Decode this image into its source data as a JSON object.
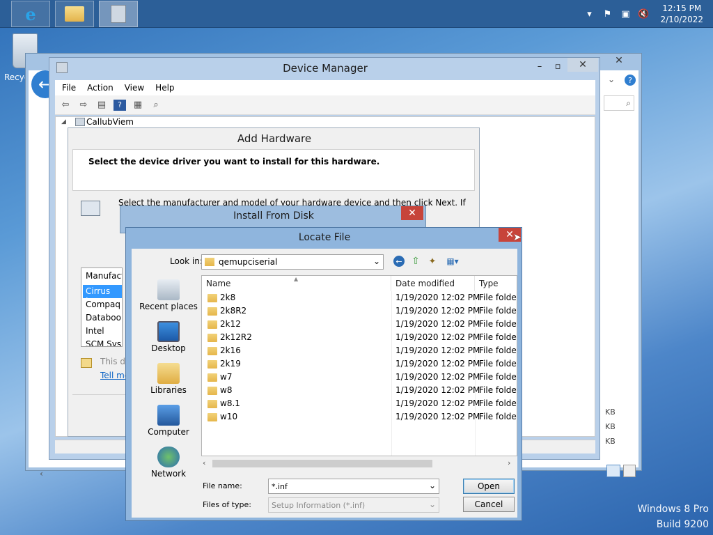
{
  "taskbar": {
    "clock_time": "12:15 PM",
    "clock_date": "2/10/2022"
  },
  "desktop": {
    "recycle_label": "Recyc",
    "watermark_line1": "Windows 8 Pro",
    "watermark_line2": "Build 9200"
  },
  "explorer": {
    "sizes": [
      "KB",
      "KB",
      "KB"
    ]
  },
  "device_manager": {
    "title": "Device Manager",
    "menu": [
      "File",
      "Action",
      "View",
      "Help"
    ],
    "tree_root": "CallubViem"
  },
  "add_hardware": {
    "title": "Add Hardware",
    "heading": "Select the device driver you want to install for this hardware.",
    "description": "Select the manufacturer and model of your hardware device and then click Next. If you have a",
    "manufacturer_header": "Manufact",
    "manufacturers": [
      "Cirrus Log",
      "Compaq",
      "Databook",
      "Intel",
      "SCM Sys"
    ],
    "signed_text": "This d",
    "tell_me_link": "Tell me"
  },
  "install_from_disk": {
    "title": "Install From Disk"
  },
  "locate_file": {
    "title": "Locate File",
    "look_in_label": "Look in:",
    "look_in_value": "qemupciserial",
    "places": [
      "Recent places",
      "Desktop",
      "Libraries",
      "Computer",
      "Network"
    ],
    "columns": [
      "Name",
      "Date modified",
      "Type"
    ],
    "files": [
      {
        "name": "2k8",
        "date": "1/19/2020 12:02 PM",
        "type": "File folder"
      },
      {
        "name": "2k8R2",
        "date": "1/19/2020 12:02 PM",
        "type": "File folder"
      },
      {
        "name": "2k12",
        "date": "1/19/2020 12:02 PM",
        "type": "File folder"
      },
      {
        "name": "2k12R2",
        "date": "1/19/2020 12:02 PM",
        "type": "File folder"
      },
      {
        "name": "2k16",
        "date": "1/19/2020 12:02 PM",
        "type": "File folder"
      },
      {
        "name": "2k19",
        "date": "1/19/2020 12:02 PM",
        "type": "File folder"
      },
      {
        "name": "w7",
        "date": "1/19/2020 12:02 PM",
        "type": "File folder"
      },
      {
        "name": "w8",
        "date": "1/19/2020 12:02 PM",
        "type": "File folder"
      },
      {
        "name": "w8.1",
        "date": "1/19/2020 12:02 PM",
        "type": "File folder"
      },
      {
        "name": "w10",
        "date": "1/19/2020 12:02 PM",
        "type": "File folder"
      }
    ],
    "file_name_label": "File name:",
    "file_name_value": "*.inf",
    "files_of_type_label": "Files of type:",
    "files_of_type_value": "Setup Information (*.inf)",
    "open_label": "Open",
    "cancel_label": "Cancel"
  },
  "icons": {
    "ie": "internet-explorer-icon",
    "explorer": "file-explorer-icon",
    "devmgr": "device-manager-icon"
  }
}
